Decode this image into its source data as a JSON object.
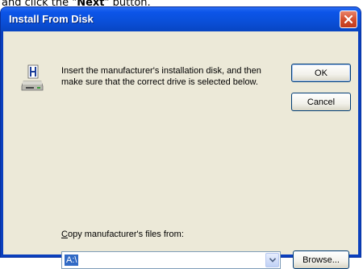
{
  "caption": {
    "prefix": "and click the \"",
    "bold": "Next",
    "suffix": "\" button."
  },
  "window": {
    "title": "Install From Disk"
  },
  "icons": {
    "disk": "floppy-disk-drive-icon",
    "close": "close-icon",
    "dropdown": "chevron-down-icon"
  },
  "message": {
    "text": "Insert the manufacturer's installation disk, and then make sure that the correct drive is selected below."
  },
  "buttons": {
    "ok": "OK",
    "cancel": "Cancel",
    "browse": "Browse..."
  },
  "copy_from": {
    "label_mnemonic": "C",
    "label_rest": "opy manufacturer's files from:",
    "value": "A:\\"
  },
  "colors": {
    "titlebar": "#0a4fd8",
    "client": "#ece9d8",
    "selection": "#316ac5",
    "close": "#d5502f"
  }
}
